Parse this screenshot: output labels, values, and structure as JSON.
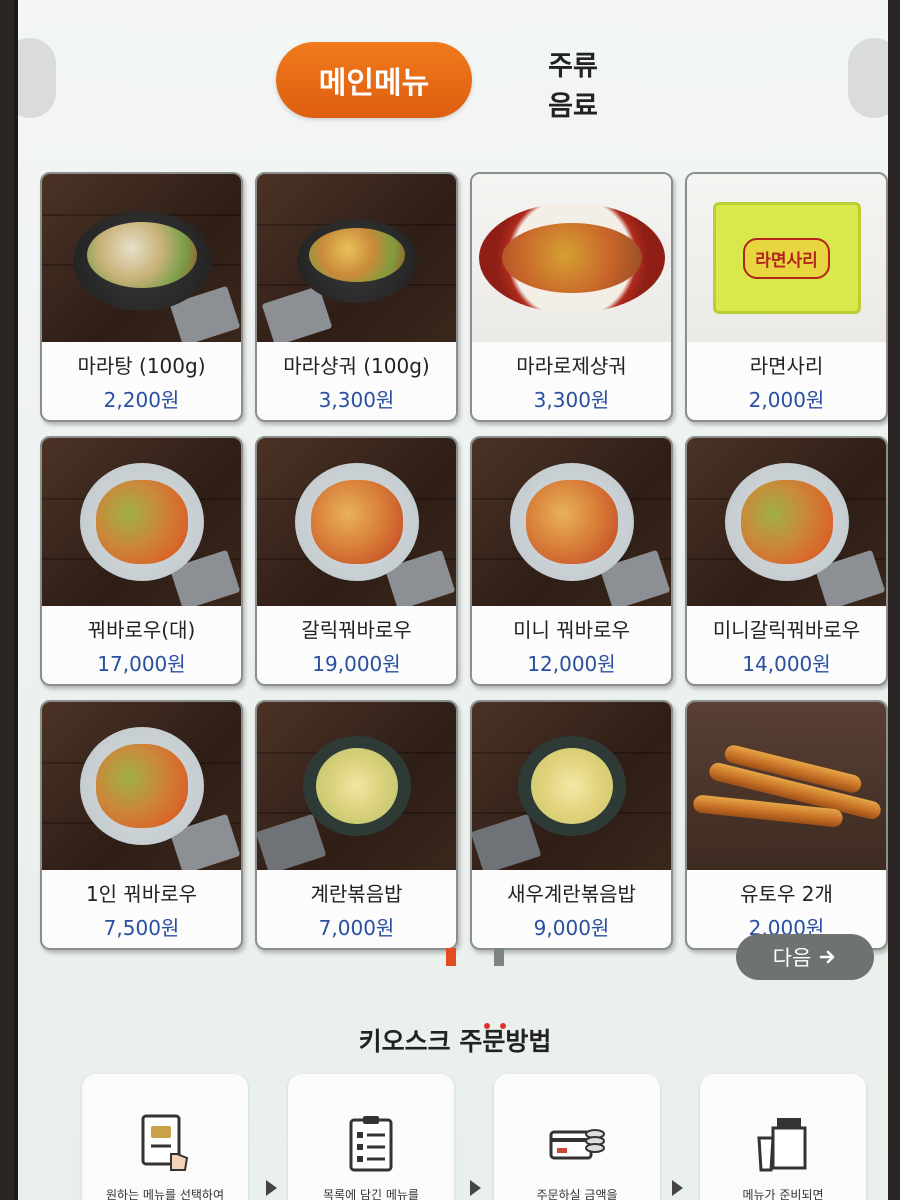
{
  "tabs": {
    "active": "메인메뉴",
    "others": [
      "주류",
      "음료"
    ]
  },
  "menu": [
    {
      "name": "마라탕 (100g)",
      "price": "2,200원",
      "photo": "bowl"
    },
    {
      "name": "마라샹궈 (100g)",
      "price": "3,300원",
      "photo": "bowl"
    },
    {
      "name": "마라로제샹궈",
      "price": "3,300원",
      "photo": "red-plate"
    },
    {
      "name": "라면사리",
      "price": "2,000원",
      "photo": "noodle-pack",
      "pack_text": "라면사리"
    },
    {
      "name": "꿔바로우(대)",
      "price": "17,000원",
      "photo": "plate"
    },
    {
      "name": "갈릭꿔바로우",
      "price": "19,000원",
      "photo": "plate"
    },
    {
      "name": "미니 꿔바로우",
      "price": "12,000원",
      "photo": "plate"
    },
    {
      "name": "미니갈릭꿔바로우",
      "price": "14,000원",
      "photo": "plate"
    },
    {
      "name": "1인 꿔바로우",
      "price": "7,500원",
      "photo": "plate"
    },
    {
      "name": "계란볶음밥",
      "price": "7,000원",
      "photo": "rice"
    },
    {
      "name": "새우계란볶음밥",
      "price": "9,000원",
      "photo": "rice"
    },
    {
      "name": "유토우 2개",
      "price": "2,000원",
      "photo": "youtiao"
    }
  ],
  "pagination": {
    "current_page": 1,
    "total_pages": 2
  },
  "next_button": {
    "label": "다음",
    "icon": "arrow-right-icon"
  },
  "howto": {
    "title": "키오스크 주문방법",
    "steps": [
      {
        "caption": "원하는 메뉴를 선택하여",
        "icon": "menu-select-icon"
      },
      {
        "caption": "목록에 담긴 메뉴를",
        "icon": "clipboard-list-icon"
      },
      {
        "caption": "주문하실 금액을",
        "icon": "card-payment-icon"
      },
      {
        "caption": "메뉴가 준비되면",
        "icon": "takeout-bag-icon"
      }
    ]
  },
  "colors": {
    "accent": "#e2661a",
    "price": "#2a4fa0",
    "pager_active": "#e24c1f",
    "next_button_bg": "#6e7372"
  }
}
